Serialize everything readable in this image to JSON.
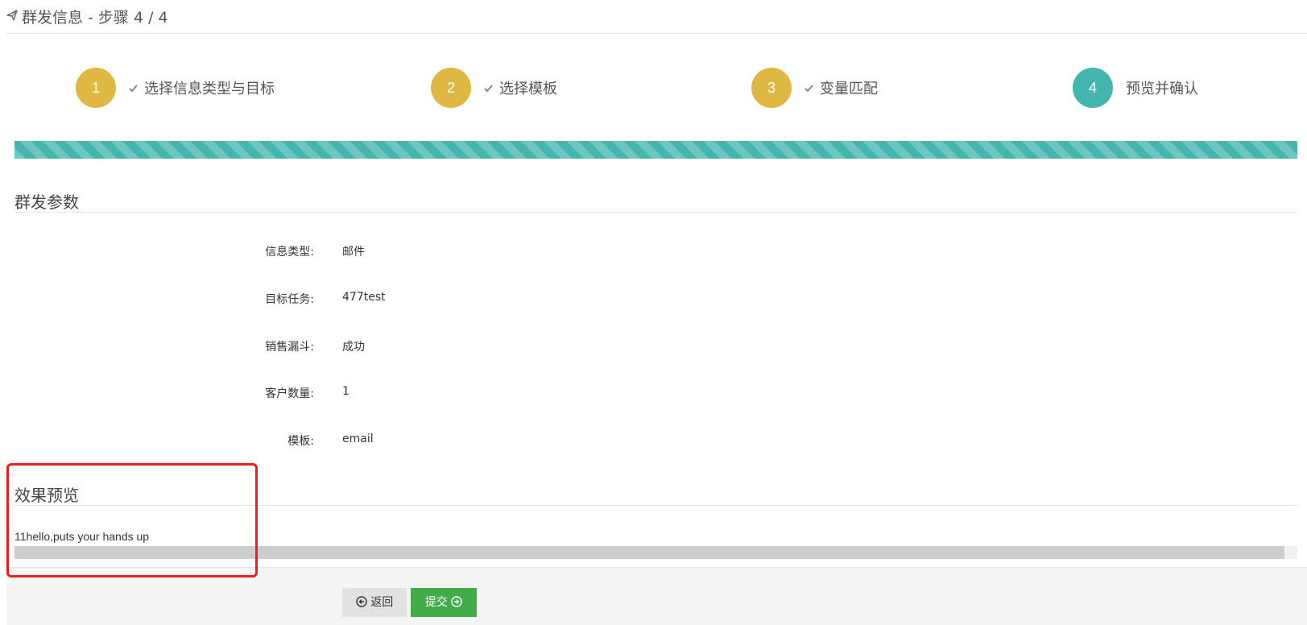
{
  "header": {
    "title": "群发信息 - 步骤 4 / 4",
    "icon": "send-icon"
  },
  "steps": [
    {
      "number": "1",
      "label": "选择信息类型与目标",
      "state": "done"
    },
    {
      "number": "2",
      "label": "选择模板",
      "state": "done"
    },
    {
      "number": "3",
      "label": "变量匹配",
      "state": "done"
    },
    {
      "number": "4",
      "label": "预览并确认",
      "state": "active"
    }
  ],
  "progress": {
    "fraction": 1.0
  },
  "params": {
    "section_title": "群发参数",
    "rows": [
      {
        "label": "信息类型:",
        "value": "邮件"
      },
      {
        "label": "目标任务:",
        "value": "477test"
      },
      {
        "label": "销售漏斗:",
        "value": "成功"
      },
      {
        "label": "客户数量:",
        "value": "1"
      },
      {
        "label": "模板:",
        "value": "email"
      }
    ]
  },
  "preview": {
    "section_title": "效果预览",
    "text": "11hello,puts your hands up"
  },
  "buttons": {
    "back": "返回",
    "submit": "提交"
  },
  "colors": {
    "step_done": "#dfb844",
    "step_active": "#45b6ae",
    "progress": "#45b6ae",
    "submit": "#43ac48",
    "highlight": "#ee1d1d"
  }
}
